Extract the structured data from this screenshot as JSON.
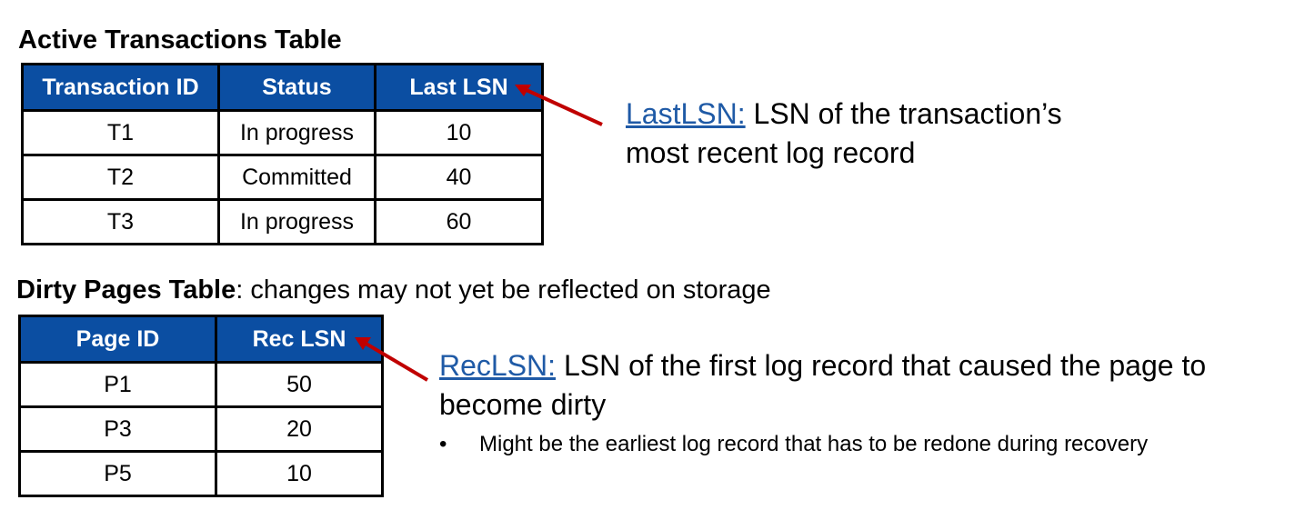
{
  "active_table": {
    "title": "Active Transactions Table",
    "columns": [
      "Transaction ID",
      "Status",
      "Last LSN"
    ],
    "rows": [
      [
        "T1",
        "In progress",
        "10"
      ],
      [
        "T2",
        "Committed",
        "40"
      ],
      [
        "T3",
        "In progress",
        "60"
      ]
    ]
  },
  "dirty_table": {
    "title": "Dirty Pages Table",
    "subtitle": ": changes may not yet be reflected on storage",
    "columns": [
      "Page ID",
      "Rec LSN"
    ],
    "rows": [
      [
        "P1",
        "50"
      ],
      [
        "P3",
        "20"
      ],
      [
        "P5",
        "10"
      ]
    ]
  },
  "last_lsn_note": {
    "term": "LastLSN:",
    "line1": " LSN of the transaction’s",
    "line2": "most recent log record"
  },
  "rec_lsn_note": {
    "term": "RecLSN:",
    "line1": " LSN of the first log record that caused the page to",
    "line2": "become dirty",
    "bullet_symbol": "•",
    "bullet": "Might be the earliest log record that has to be redone during recovery"
  },
  "colors": {
    "header_bg": "#0b4ea2",
    "header_text": "#ffffff",
    "term_link": "#1f5aa6",
    "arrow": "#c00000"
  },
  "icons": [
    "arrow-icon"
  ]
}
